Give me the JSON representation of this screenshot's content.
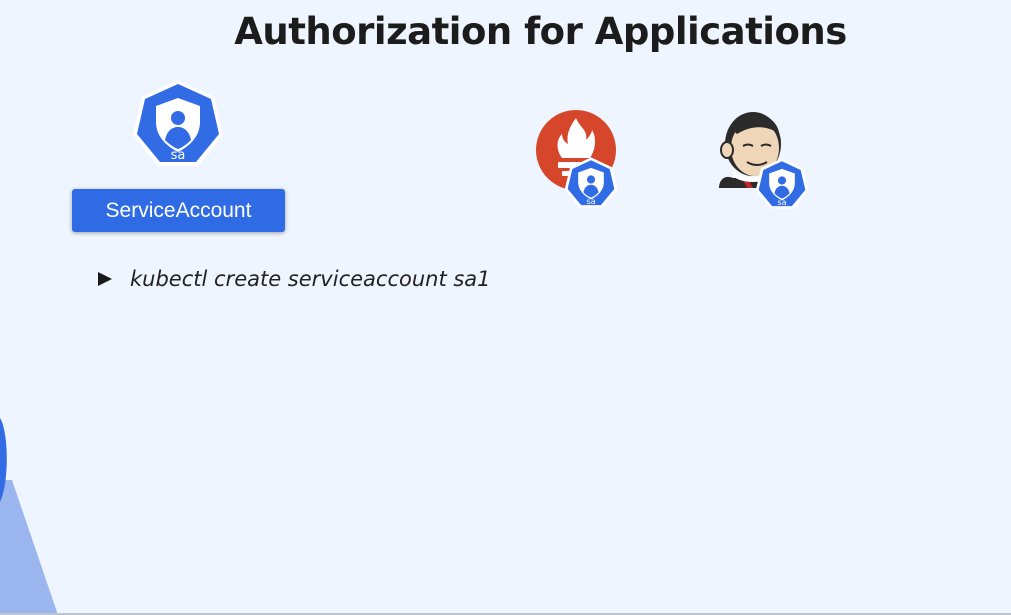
{
  "slide": {
    "title": "Authorization for Applications",
    "service_account_label": "ServiceAccount",
    "bullets": [
      {
        "text": "kubectl create serviceaccount sa1"
      }
    ],
    "icon_caption": "sa"
  },
  "icons": {
    "service_account": "service-account-icon",
    "prometheus": "prometheus-icon",
    "jenkins": "jenkins-icon",
    "bullet": "triangle-bullet-icon"
  },
  "colors": {
    "background": "#eff5fe",
    "accent": "#2f6be4",
    "title": "#1c1c1c",
    "prometheus": "#d6462a",
    "decoration": "#9bb6ef"
  }
}
